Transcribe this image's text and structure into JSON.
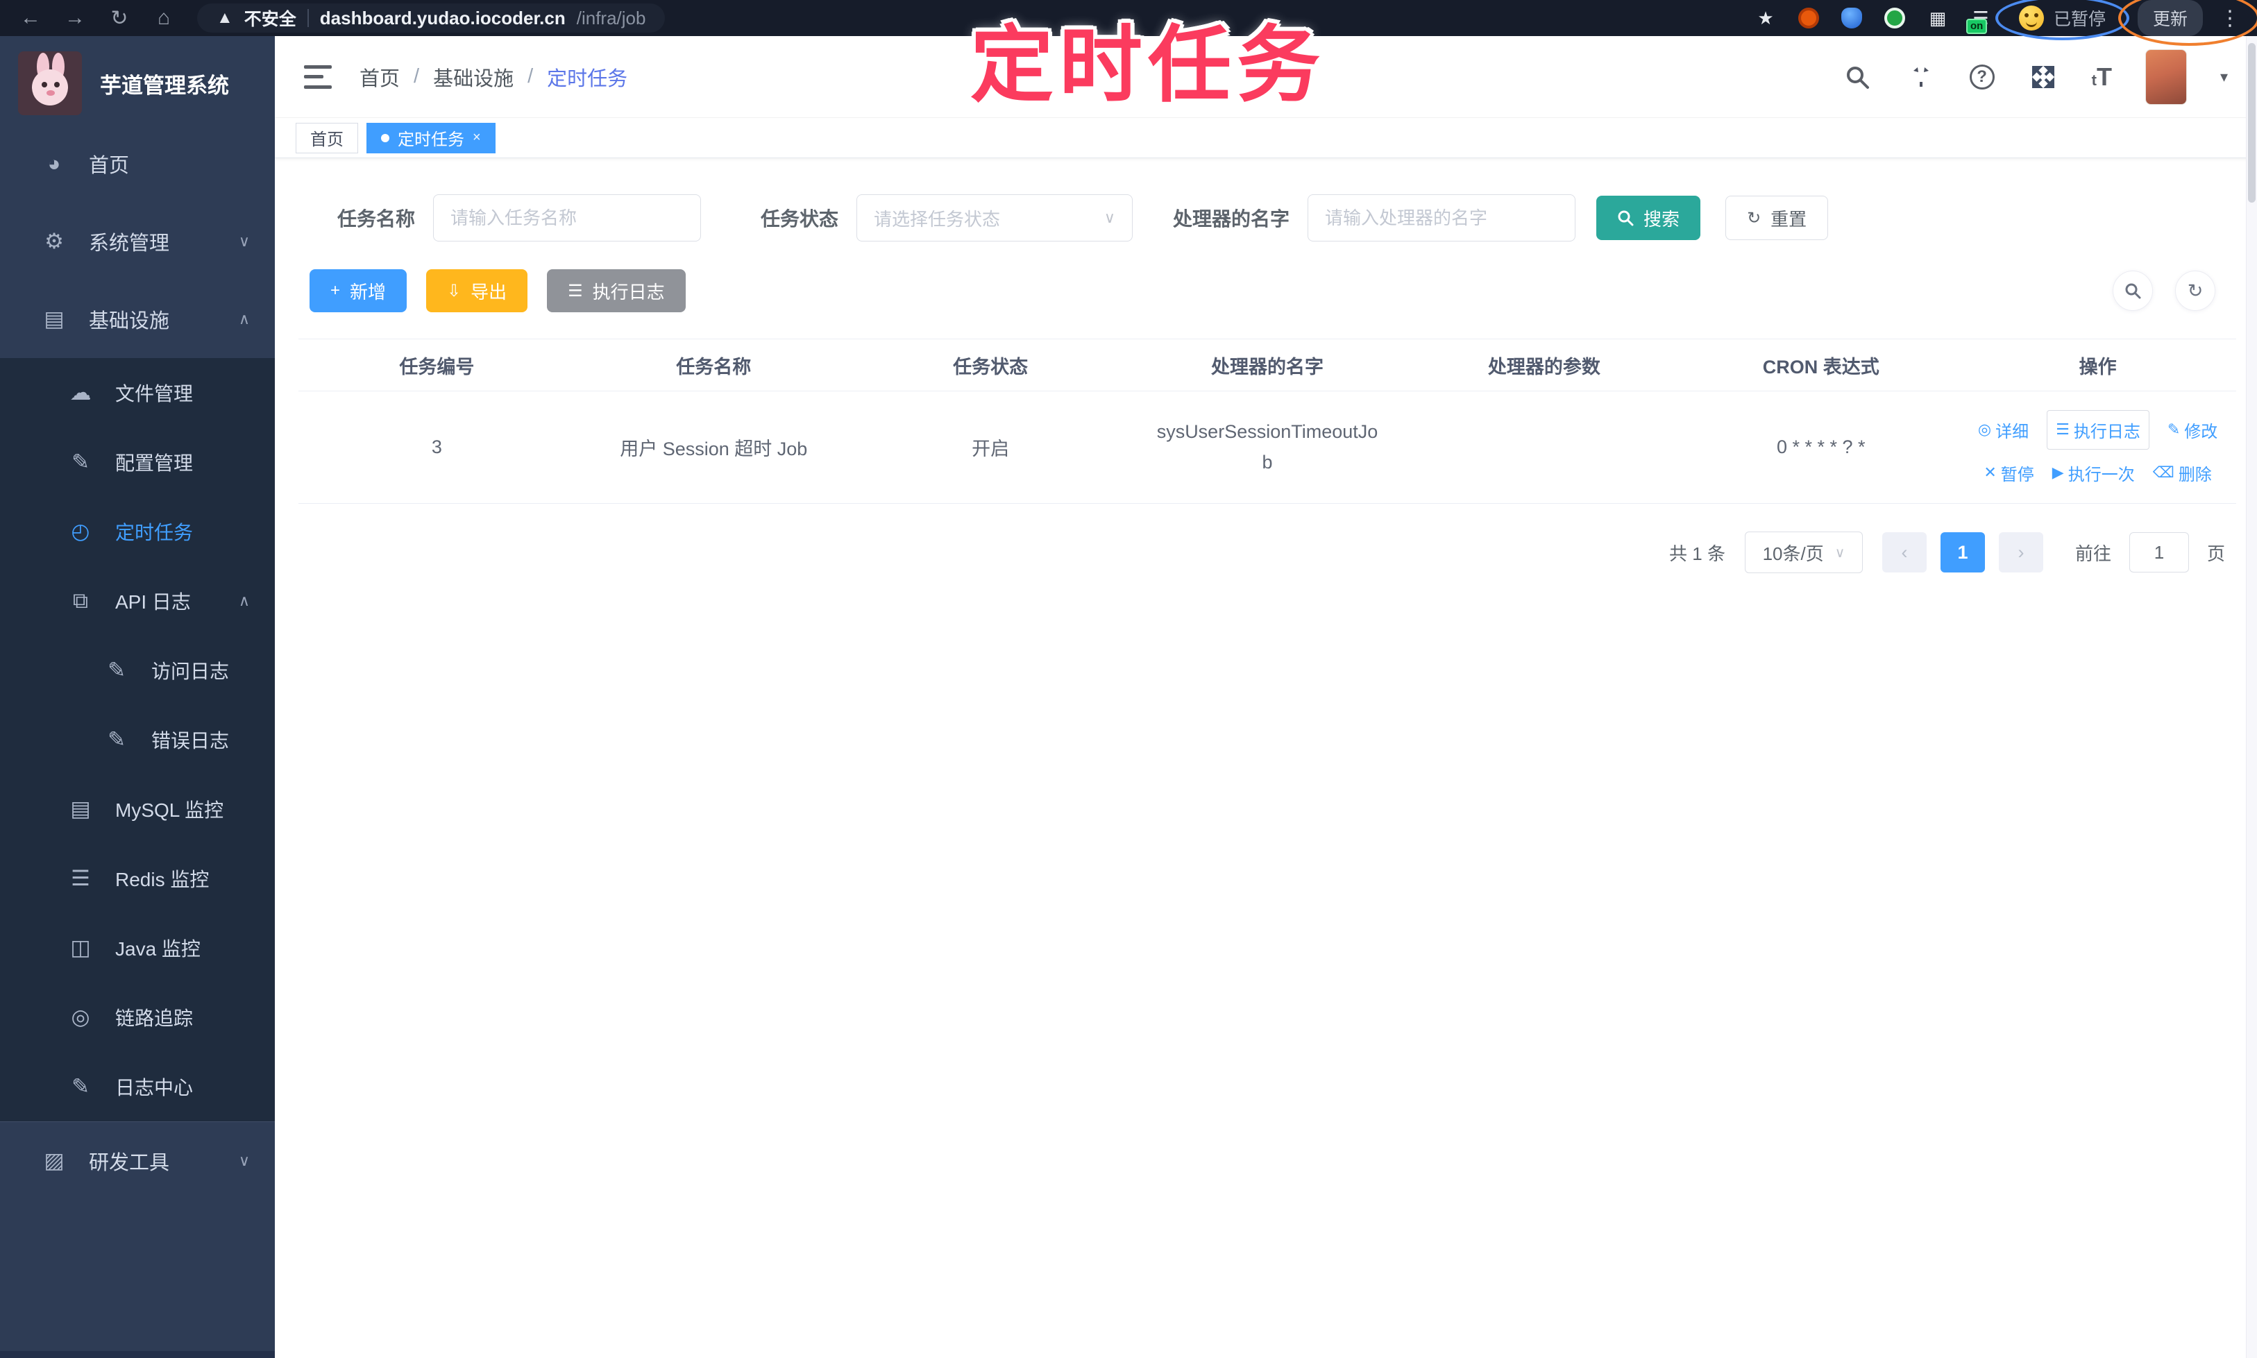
{
  "browser": {
    "security_label": "不安全",
    "url_host": "dashboard.yudao.iocoder.cn",
    "url_path": "/infra/job",
    "extension_badge": "on",
    "paused_label": "已暂停",
    "update_label": "更新"
  },
  "overlay": {
    "title": "定时任务"
  },
  "sidebar": {
    "app_title": "芋道管理系统",
    "items": [
      {
        "label": "首页"
      },
      {
        "label": "系统管理"
      },
      {
        "label": "基础设施"
      }
    ],
    "sub_items": [
      {
        "label": "文件管理"
      },
      {
        "label": "配置管理"
      },
      {
        "label": "定时任务"
      },
      {
        "label": "API 日志"
      },
      {
        "label": "访问日志"
      },
      {
        "label": "错误日志"
      },
      {
        "label": "MySQL 监控"
      },
      {
        "label": "Redis 监控"
      },
      {
        "label": "Java 监控"
      },
      {
        "label": "链路追踪"
      },
      {
        "label": "日志中心"
      }
    ],
    "bottom_item": {
      "label": "研发工具"
    }
  },
  "header": {
    "breadcrumb": [
      "首页",
      "基础设施",
      "定时任务"
    ],
    "separator": "/"
  },
  "tabs": [
    {
      "label": "首页"
    },
    {
      "label": "定时任务",
      "close": "×"
    }
  ],
  "filters": {
    "name_label": "任务名称",
    "name_placeholder": "请输入任务名称",
    "status_label": "任务状态",
    "status_placeholder": "请选择任务状态",
    "handler_label": "处理器的名字",
    "handler_placeholder": "请输入处理器的名字",
    "search_label": "搜索",
    "reset_label": "重置"
  },
  "toolbar": {
    "add_label": "新增",
    "export_label": "导出",
    "exec_log_label": "执行日志"
  },
  "table": {
    "columns": [
      "任务编号",
      "任务名称",
      "任务状态",
      "处理器的名字",
      "处理器的参数",
      "CRON 表达式",
      "操作"
    ],
    "row": {
      "id": "3",
      "name": "用户 Session 超时 Job",
      "status": "开启",
      "handler": "sysUserSessionTimeoutJob",
      "param": "",
      "cron": "0 * * * * ? *"
    },
    "actions": {
      "detail": "详细",
      "exec_log": "执行日志",
      "edit": "修改",
      "pause": "暂停",
      "run_once": "执行一次",
      "delete": "删除"
    }
  },
  "pagination": {
    "total": "共 1 条",
    "page_size": "10条/页",
    "current_page": "1",
    "goto_label": "前往",
    "goto_value": "1",
    "page_unit": "页"
  },
  "colors": {
    "accent_blue": "#409eff",
    "teal": "#2ba89b",
    "warning_yellow": "#ffb71d",
    "gray_button": "#909399",
    "annotation_pink": "#fb3b5e",
    "sidebar_bg": "#2e3c55",
    "submenu_bg": "#1f2c3e"
  }
}
